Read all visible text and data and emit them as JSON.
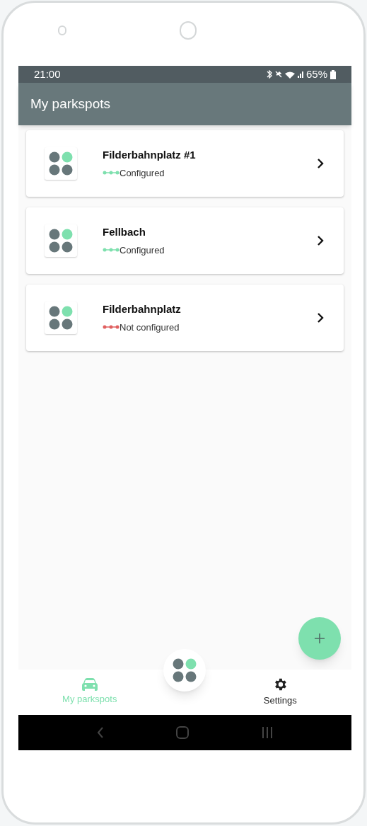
{
  "status_bar": {
    "time": "21:00",
    "battery": "65%"
  },
  "app_bar": {
    "title": "My parkspots"
  },
  "parkspots": [
    {
      "name": "Filderbahnplatz #1",
      "status": "Configured",
      "configured": true
    },
    {
      "name": "Fellbach",
      "status": "Configured",
      "configured": true
    },
    {
      "name": "Filderbahnplatz",
      "status": "Not configured",
      "configured": false
    }
  ],
  "bottom_nav": [
    {
      "label": "My parkspots",
      "kind": "car",
      "selected": true
    },
    {
      "label": "Settings",
      "kind": "gear",
      "selected": false
    }
  ]
}
